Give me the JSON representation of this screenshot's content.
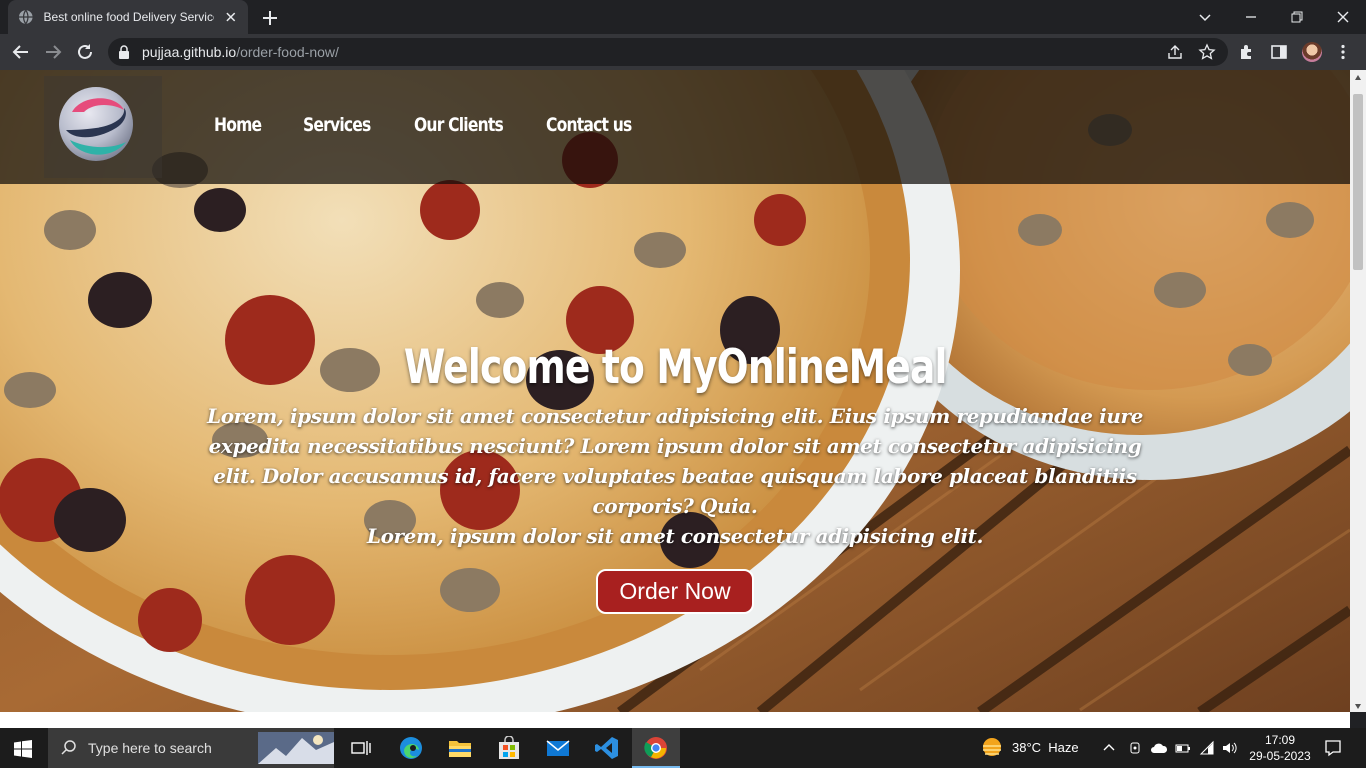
{
  "browser": {
    "tab_title": "Best online food Delivery Service",
    "url_domain": "pujjaa.github.io",
    "url_path": "/order-food-now/"
  },
  "site": {
    "nav": [
      "Home",
      "Services",
      "Our Clients",
      "Contact us"
    ],
    "hero_title": "Welcome to MyOnlineMeal",
    "hero_text": "Lorem, ipsum dolor sit amet consectetur adipisicing elit. Eius ipsum repudiandae iure expedita necessitatibus nesciunt? Lorem ipsum dolor sit amet consectetur adipisicing elit. Dolor accusamus id, facere voluptates beatae quisquam labore placeat blanditiis corporis? Quia.",
    "hero_text_2": "Lorem, ipsum dolor sit amet consectetur adipisicing elit.",
    "cta": "Order Now"
  },
  "taskbar": {
    "search_placeholder": "Type here to search",
    "temperature": "38°C",
    "weather": "Haze",
    "time": "17:09",
    "date": "29-05-2023"
  },
  "colors": {
    "cta_bg": "#a8201f",
    "header_overlay": "#0f0c0a",
    "chrome_toolbar": "#35363a"
  },
  "icons": [
    "globe-icon",
    "close-icon",
    "plus-icon",
    "chevron-down-icon",
    "minimize-icon",
    "restore-icon",
    "back-icon",
    "forward-icon",
    "reload-icon",
    "lock-icon",
    "share-icon",
    "star-icon",
    "extensions-icon",
    "sidepanel-icon",
    "menu-icon",
    "windows-icon",
    "search-icon",
    "taskview-icon",
    "edge-icon",
    "explorer-icon",
    "store-icon",
    "mail-icon",
    "vscode-icon",
    "chrome-icon",
    "weather-icon",
    "network-icon",
    "volume-icon",
    "notification-icon"
  ]
}
